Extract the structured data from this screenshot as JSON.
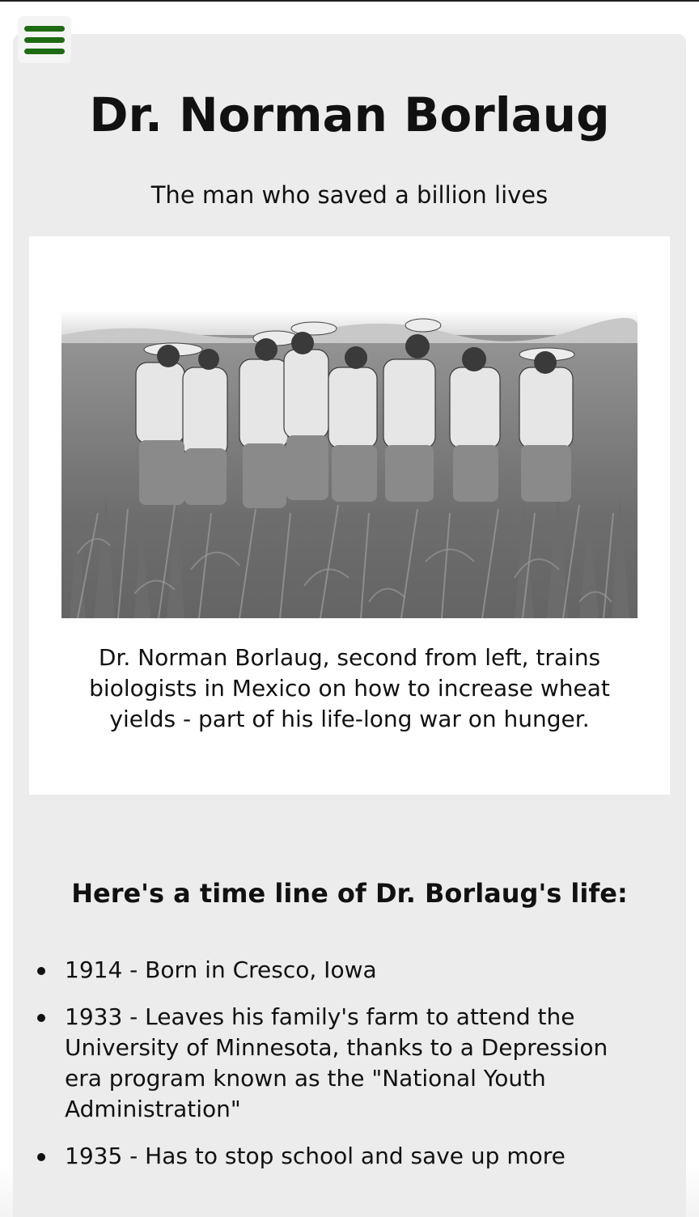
{
  "header": {
    "menu_icon": "hamburger-menu-icon",
    "menu_color": "#1f6b12"
  },
  "hero": {
    "title": "Dr. Norman Borlaug",
    "subtitle": "The man who saved a billion lives"
  },
  "figure": {
    "caption": "Dr. Norman Borlaug, second from left, trains biologists in Mexico on how to increase wheat yields - part of his life-long war on hunger."
  },
  "timeline": {
    "heading": "Here's a time line of Dr. Borlaug's life:",
    "items": [
      {
        "text": "1914 - Born in Cresco, Iowa"
      },
      {
        "text": "1933 - Leaves his family's farm to attend the University of Minnesota, thanks to a Depression era program known as the \"National Youth Administration\""
      },
      {
        "text": "1935 - Has to stop school and save up more"
      }
    ]
  },
  "colors": {
    "page_background": "#ffffff",
    "card_background": "#ececec",
    "figure_background": "#ffffff",
    "text": "#111111"
  }
}
